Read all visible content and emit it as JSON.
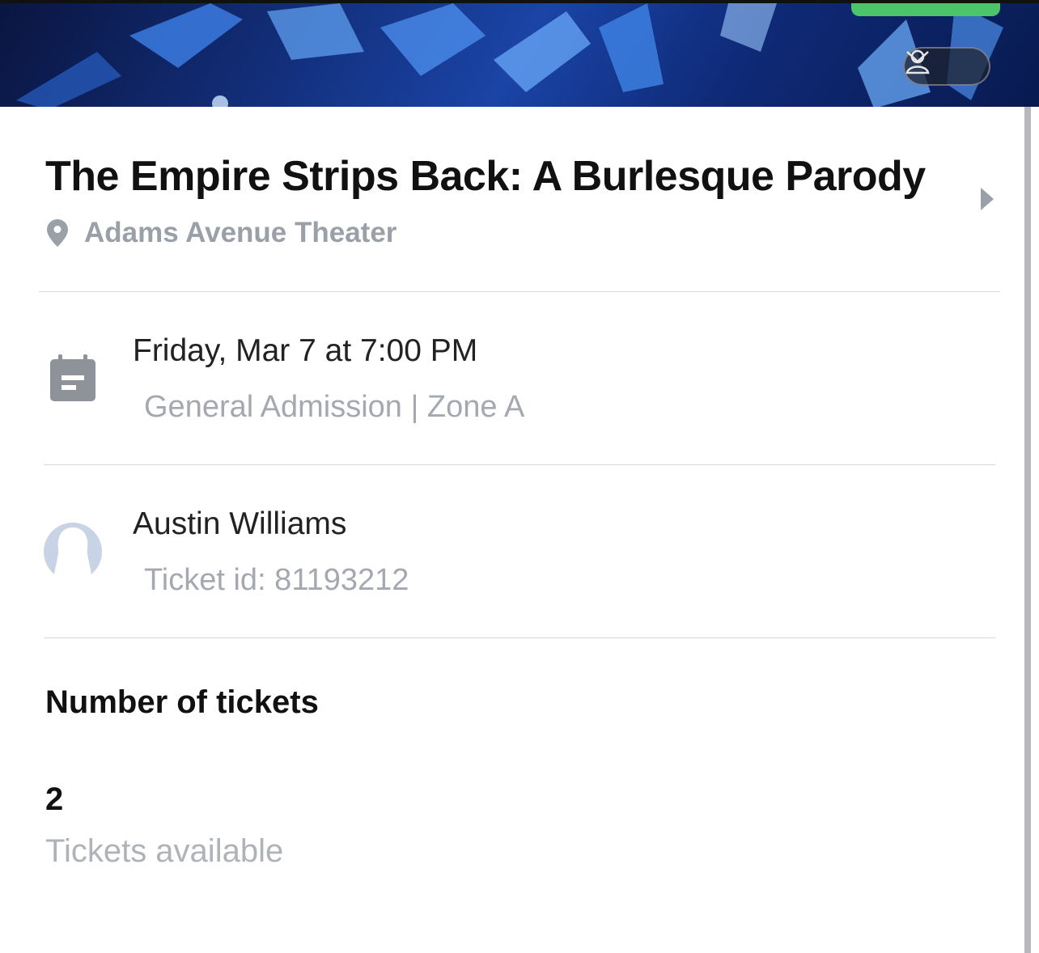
{
  "event": {
    "title": "The Empire Strips Back: A Burlesque Parody",
    "venue": "Adams Avenue Theater"
  },
  "schedule": {
    "datetime": "Friday, Mar 7 at 7:00 PM",
    "admission": "General Admission | Zone A"
  },
  "holder": {
    "name": "Austin Williams",
    "ticket_id": "Ticket id: 81193212"
  },
  "tickets": {
    "section_title": "Number of tickets",
    "count": "2",
    "label": "Tickets available"
  },
  "icons": {
    "account": "user-icon",
    "dropdown": "chevron-down-icon",
    "venue": "location-pin-icon",
    "date": "calendar-icon",
    "holder": "avatar",
    "details": "chevron-right-icon"
  },
  "colors": {
    "accent_green": "#4cc46a",
    "muted_text": "#9aa0a8",
    "hero_blue": "#1a44a6"
  }
}
